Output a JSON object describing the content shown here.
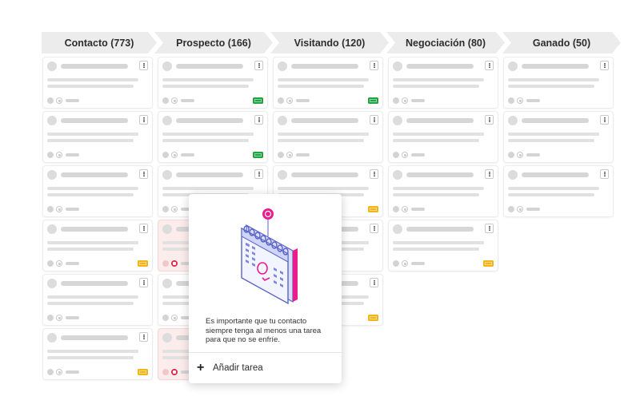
{
  "stages": [
    {
      "label": "Contacto (773)"
    },
    {
      "label": "Prospecto (166)"
    },
    {
      "label": "Visitando (120)"
    },
    {
      "label": "Negociación (80)"
    },
    {
      "label": "Ganado (50)"
    }
  ],
  "columns": [
    {
      "stage": "Contacto",
      "cards": [
        {
          "status": "normal",
          "tag": null
        },
        {
          "status": "normal",
          "tag": null
        },
        {
          "status": "normal",
          "tag": null
        },
        {
          "status": "normal",
          "tag": "yellow"
        },
        {
          "status": "normal",
          "tag": null
        },
        {
          "status": "normal",
          "tag": "yellow"
        }
      ]
    },
    {
      "stage": "Prospecto",
      "cards": [
        {
          "status": "normal",
          "tag": "green"
        },
        {
          "status": "normal",
          "tag": "green"
        },
        {
          "status": "normal",
          "tag": null
        },
        {
          "status": "no-task",
          "tag": null
        },
        {
          "status": "normal",
          "tag": null
        },
        {
          "status": "no-task",
          "tag": null
        }
      ]
    },
    {
      "stage": "Visitando",
      "cards": [
        {
          "status": "normal",
          "tag": "green"
        },
        {
          "status": "normal",
          "tag": null
        },
        {
          "status": "normal",
          "tag": "yellow"
        },
        {
          "status": "normal",
          "tag": null
        },
        {
          "status": "normal",
          "tag": "yellow"
        }
      ]
    },
    {
      "stage": "Negociación",
      "cards": [
        {
          "status": "normal",
          "tag": null
        },
        {
          "status": "normal",
          "tag": null
        },
        {
          "status": "normal",
          "tag": null
        },
        {
          "status": "normal",
          "tag": "yellow"
        }
      ]
    },
    {
      "stage": "Ganado",
      "cards": [
        {
          "status": "normal",
          "tag": null
        },
        {
          "status": "normal",
          "tag": null
        },
        {
          "status": "normal",
          "tag": null
        }
      ]
    }
  ],
  "popover": {
    "message": "Es importante que tu contacto siempre tenga al menos una tarea para que no se enfríe.",
    "add_task_label": "Añadir tarea",
    "illustration": "calendar-icon"
  },
  "colors": {
    "tag_green": "#22a244",
    "tag_yellow": "#f3b31a",
    "no_task_red": "#e32a46",
    "accent_pink": "#e91e8c",
    "illustration_blue": "#5a63c8"
  }
}
